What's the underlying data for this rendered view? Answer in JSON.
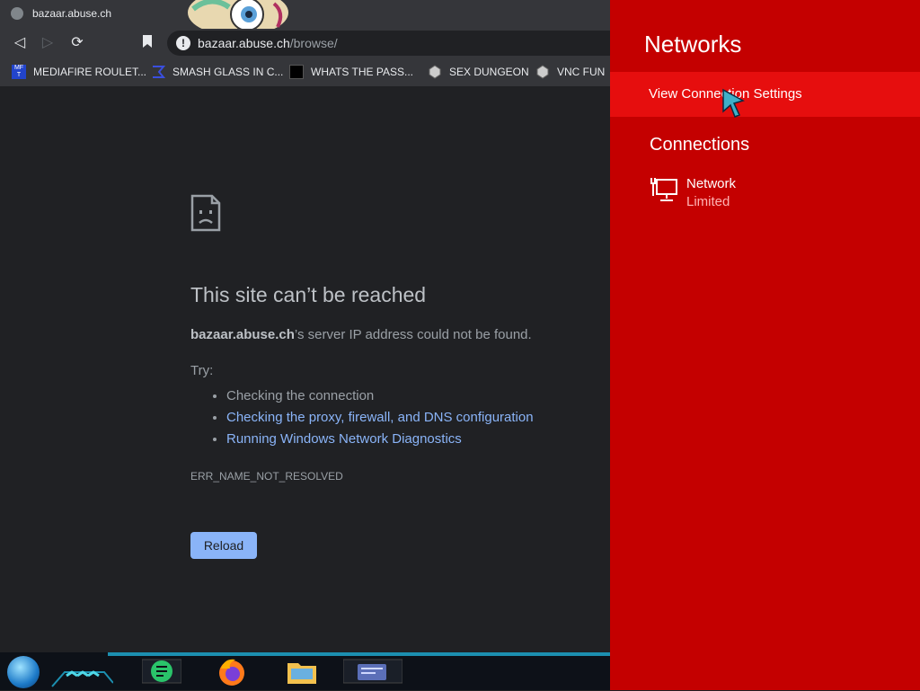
{
  "browser": {
    "tab_title": "bazaar.abuse.ch",
    "url_host": "bazaar.abuse.ch",
    "url_path": "/browse/",
    "bookmarks": [
      {
        "label": "MEDIAFIRE ROULET...",
        "icon": "mediafire-icon"
      },
      {
        "label": "SMASH GLASS IN C...",
        "icon": "smash-glass-icon"
      },
      {
        "label": "WHATS THE PASS...",
        "icon": "password-icon"
      },
      {
        "label": "SEX DUNGEON",
        "icon": "dungeon-icon"
      },
      {
        "label": "VNC FUN",
        "icon": "vnc-icon"
      }
    ]
  },
  "error_page": {
    "title": "This site can’t be reached",
    "host": "bazaar.abuse.ch",
    "description_rest": "’s server IP address could not be found.",
    "try_label": "Try:",
    "suggestions": [
      "Checking the connection",
      "Checking the proxy, firewall, and DNS configuration",
      "Running Windows Network Diagnostics"
    ],
    "error_code": "ERR_NAME_NOT_RESOLVED",
    "reload_label": "Reload"
  },
  "networks_panel": {
    "title": "Networks",
    "view_settings_label": "View Connection Settings",
    "connections_title": "Connections",
    "network": {
      "name": "Network",
      "status": "Limited"
    },
    "colors": {
      "background": "#c40000",
      "highlight": "#e60e0e"
    }
  },
  "taskbar": {
    "apps": [
      "start-orb-icon",
      "notes-app-icon",
      "firefox-icon",
      "file-explorer-icon",
      "media-app-icon"
    ]
  }
}
